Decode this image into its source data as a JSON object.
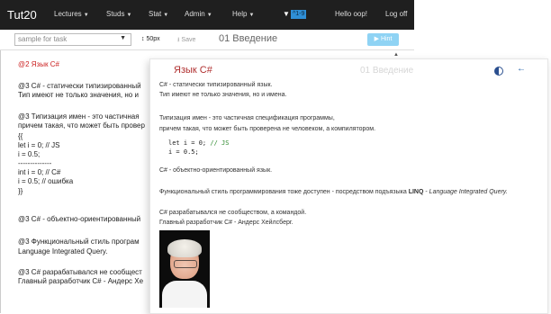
{
  "navbar": {
    "brand": "Tut20",
    "items": [
      {
        "label": "Lectures"
      },
      {
        "label": "Studs"
      },
      {
        "label": "Stat"
      },
      {
        "label": "Admin"
      },
      {
        "label": "Help"
      }
    ],
    "filter_badge": "^1-9",
    "greeting": "Hello oop!",
    "logout": "Log off"
  },
  "toolbar": {
    "task_select_value": "sample for task",
    "height_label": "50px",
    "save_label": "Save",
    "lesson_title": "01 Введение",
    "hint_label": "Hint"
  },
  "editor": {
    "lines": [
      "@2 Язык C#",
      "@3 C# - статически типизированный",
      "Тип имеют не только значения, но и",
      "@3 Типизация имен - это частичная",
      "причем такая, что может быть провер",
      "{{",
      "let i = 0;  // JS",
      "i = 0.5;",
      "--------------",
      "int i = 0;  // C#",
      "i = 0.5;    // ошибка",
      "}}",
      "@3 C# - объектно-ориентированный",
      "@3 Функциональный стиль програм",
      "Language Integrated Query.",
      "@3 C# разрабатывался не сообщест",
      "Главный разработчик C# - Андерс Хе"
    ]
  },
  "preview": {
    "title": "Язык C#",
    "faded_header": "01 Введение",
    "p1_line1": "C# - статически типизированный язык.",
    "p1_line2": "Тип имеют не только значения, но и имена.",
    "p2_line1": "Типизация имен - это частичная спецификация программы,",
    "p2_line2": "причем такая, что может быть проверена не человеком, а компилятором.",
    "code_line1": "let i = 0;",
    "code_comment": "// JS",
    "code_line2": "i = 0.5;",
    "p3": "C# - объектно-ориентированный язык.",
    "p4_pre": "Функциональный стиль программирования тоже доступен - посредством подъязыка ",
    "p4_bold": "LINQ",
    "p4_dash": " - ",
    "p4_italic": "Language Integrated Query.",
    "p5_line1": "C# разрабатывался не сообществом, а командой.",
    "p5_line2": "Главный разработчик C# - Андерс Хейлсберг."
  }
}
